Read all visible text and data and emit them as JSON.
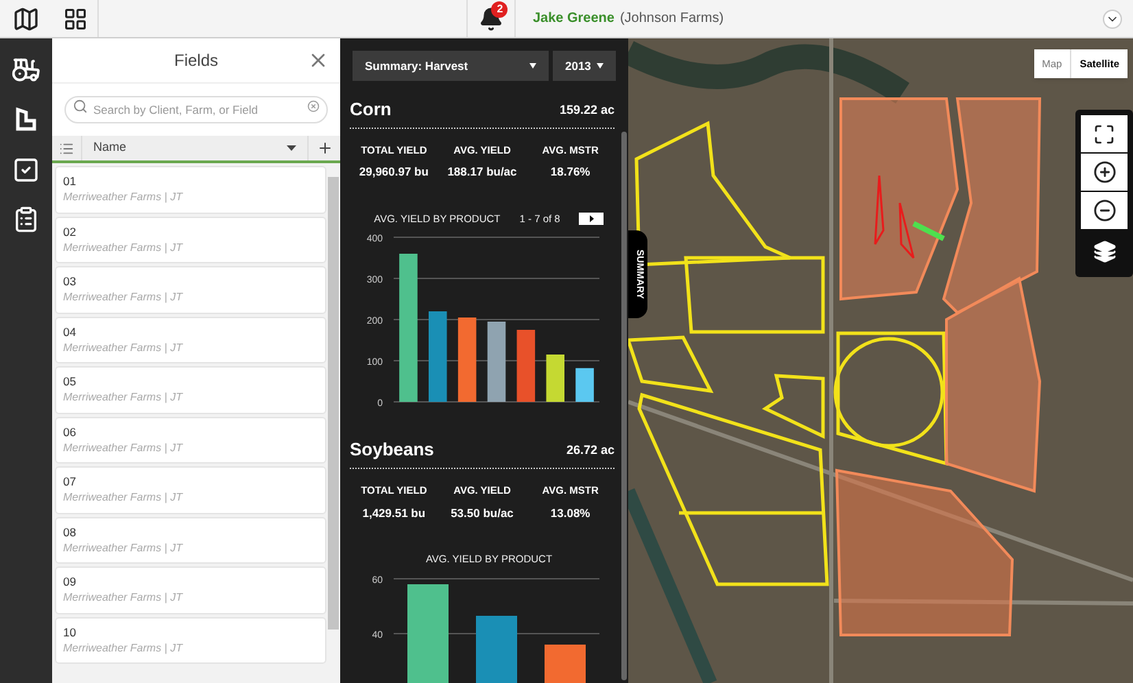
{
  "top_bar": {
    "notifications": {
      "count": "2"
    },
    "user": {
      "name": "Jake Greene",
      "org": "(Johnson Farms)"
    }
  },
  "fields_panel": {
    "title": "Fields",
    "search": {
      "placeholder": "Search by Client, Farm, or Field"
    },
    "column": {
      "label": "Name"
    },
    "items": [
      {
        "name": "01",
        "detail": "Merriweather Farms | JT"
      },
      {
        "name": "02",
        "detail": "Merriweather Farms | JT"
      },
      {
        "name": "03",
        "detail": "Merriweather Farms | JT"
      },
      {
        "name": "04",
        "detail": "Merriweather Farms | JT"
      },
      {
        "name": "05",
        "detail": "Merriweather Farms | JT"
      },
      {
        "name": "06",
        "detail": "Merriweather Farms | JT"
      },
      {
        "name": "07",
        "detail": "Merriweather Farms | JT"
      },
      {
        "name": "08",
        "detail": "Merriweather Farms | JT"
      },
      {
        "name": "09",
        "detail": "Merriweather Farms | JT"
      },
      {
        "name": "10",
        "detail": "Merriweather Farms | JT"
      }
    ]
  },
  "summary": {
    "report": {
      "value": "Summary: Harvest"
    },
    "year": {
      "value": "2013"
    },
    "tab_label": "SUMMARY",
    "crops": [
      {
        "name": "Corn",
        "area": "159.22 ac",
        "stats": [
          {
            "label": "TOTAL YIELD",
            "value": "29,960.97 bu"
          },
          {
            "label": "AVG. YIELD",
            "value": "188.17 bu/ac"
          },
          {
            "label": "AVG. MSTR",
            "value": "18.76%"
          }
        ],
        "chart_title": "AVG. YIELD BY PRODUCT",
        "pager": "1 - 7 of 8",
        "chart_data": {
          "type": "bar",
          "grid": true,
          "ylim": [
            0,
            400
          ],
          "yticks": [
            0,
            100,
            200,
            300,
            400
          ],
          "series": [
            {
              "values": [
                360,
                220,
                205,
                195,
                175,
                115,
                82
              ]
            }
          ],
          "colors": [
            "#4fc08d",
            "#1a8fb5",
            "#f26a30",
            "#8fa3b0",
            "#e8512a",
            "#c5d932",
            "#5bc8f0"
          ]
        }
      },
      {
        "name": "Soybeans",
        "area": "26.72 ac",
        "stats": [
          {
            "label": "TOTAL YIELD",
            "value": "1,429.51 bu"
          },
          {
            "label": "AVG. YIELD",
            "value": "53.50 bu/ac"
          },
          {
            "label": "AVG. MSTR",
            "value": "13.08%"
          }
        ],
        "chart_title": "AVG. YIELD BY PRODUCT",
        "chart_data": {
          "type": "bar",
          "grid": true,
          "ylim": [
            0,
            60
          ],
          "yticks": [
            40,
            60
          ],
          "series": [
            {
              "values": [
                58,
                46.5,
                36
              ]
            }
          ],
          "colors": [
            "#4fc08d",
            "#1a8fb5",
            "#f26a30"
          ]
        }
      }
    ]
  },
  "map": {
    "types": [
      {
        "label": "Map",
        "selected": false
      },
      {
        "label": "Satellite",
        "selected": true
      }
    ]
  }
}
